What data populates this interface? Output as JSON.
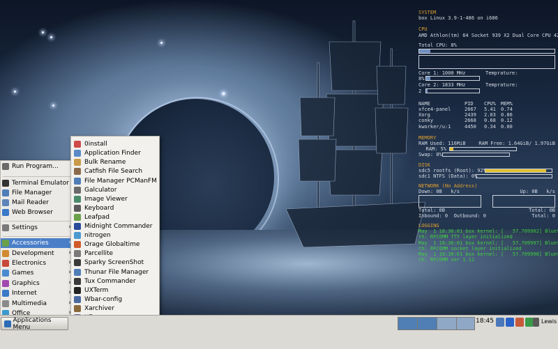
{
  "conky": {
    "system_header": "SYSTEM",
    "system_line": "box Linux 3.9-1-486 on i686",
    "cpu_header": "CPU",
    "cpu_model": "AMD Athlon(tm) 64 Socket 939 X2 Dual Core CPU 4200+",
    "total_cpu": "Total CPU: 8%",
    "total_cpu_level": 0.08,
    "core1": "Core 1: 1000 MHz",
    "core1_temp": "Temprature:",
    "core1_pct": "8%",
    "core1_level": 0.08,
    "core2": "Core 2: 1833 MHz",
    "core2_temp": "Temprature:",
    "core2_pct": "2",
    "core2_level": 0.02,
    "proc_headers": [
      "NAME",
      "PID",
      "CPU%",
      "MEM%"
    ],
    "processes": [
      [
        "xfce4-panel",
        "2667",
        "5.41",
        "0.74"
      ],
      [
        "Xorg",
        "2439",
        "2.03",
        "0.86"
      ],
      [
        "conky",
        "2668",
        "0.68",
        "0.12"
      ],
      [
        "kworker/u:1",
        "4450",
        "0.34",
        "0.00"
      ]
    ],
    "memory_header": "MEMORY",
    "ram_used": "RAM Used: 116MiB",
    "ram_free": "RAM Free: 1.64GiB/ 1.97GiB",
    "ram_pct": "RAM: 5%",
    "ram_level": 0.05,
    "swap_pct": "Swap: 0%",
    "swap_level": 0.0,
    "disk_header": "DISK",
    "disk1": "sdc5 rootfs (Root): 92%",
    "disk1_level": 0.92,
    "disk2": "sdc1 NTFS (Data): 0%",
    "disk2_level": 0.0,
    "network_header": "NETWORK (No Address)",
    "down": "Down: 0B",
    "down_unit": "k/s",
    "up": "Up: 0B",
    "up_unit": "k/s",
    "total_left": "Total: 0B",
    "total_right": "Total: 0B",
    "inbound": "Inbound: 0  Outbound: 0",
    "total_conn": "Total: 0",
    "logging_header": "LOGGING",
    "logs": [
      "May  1 18:36:01 box kernel: [   57.709902] Blueto",
      "th: RFCOMM TTY layer initialized",
      "May  1 18:36:01 box kernel: [   57.709997] Blueto",
      "th: RFCOMM socket layer initialized",
      "May  1 18:36:01 box kernel: [   57.709998] Blueto",
      "th: RFCOMM ver 1.11"
    ]
  },
  "app_menu": {
    "items": [
      {
        "label": "Run Program...",
        "icon": "run-icon",
        "color": "#6a6a6a"
      },
      {
        "label": "Terminal Emulator",
        "icon": "terminal-icon",
        "color": "#333333"
      },
      {
        "label": "File Manager",
        "icon": "folder-icon",
        "color": "#4f7db8"
      },
      {
        "label": "Mail Reader",
        "icon": "mail-icon",
        "color": "#5d84b8"
      },
      {
        "label": "Web Browser",
        "icon": "globe-icon",
        "color": "#3a78c8"
      },
      {
        "label": "Settings",
        "icon": "settings-icon",
        "color": "#7a7a7a"
      },
      {
        "label": "Accessories",
        "icon": "accessories-icon",
        "color": "#6aa04a"
      },
      {
        "label": "Development",
        "icon": "development-icon",
        "color": "#d08a30"
      },
      {
        "label": "Electronics",
        "icon": "electronics-icon",
        "color": "#c84a3a"
      },
      {
        "label": "Games",
        "icon": "games-icon",
        "color": "#4a8ad0"
      },
      {
        "label": "Graphics",
        "icon": "graphics-icon",
        "color": "#a04ab0"
      },
      {
        "label": "Internet",
        "icon": "internet-icon",
        "color": "#3a78c8"
      },
      {
        "label": "Multimedia",
        "icon": "multimedia-icon",
        "color": "#8a8a8a"
      },
      {
        "label": "Office",
        "icon": "office-icon",
        "color": "#3a9ad0"
      },
      {
        "label": "System",
        "icon": "system-icon",
        "color": "#707070"
      }
    ]
  },
  "submenu": {
    "items": [
      {
        "label": "0install",
        "icon": "zeroinstall-icon",
        "color": "#d04a4a"
      },
      {
        "label": "Application Finder",
        "icon": "app-finder-icon",
        "color": "#5a8ac8"
      },
      {
        "label": "Bulk Rename",
        "icon": "bulk-rename-icon",
        "color": "#c89a4a"
      },
      {
        "label": "Catfish File Search",
        "icon": "catfish-icon",
        "color": "#8a6a4a"
      },
      {
        "label": "File Manager PCManFM",
        "icon": "pcmanfm-icon",
        "color": "#4f7db8"
      },
      {
        "label": "Galculator",
        "icon": "calculator-icon",
        "color": "#6a6a6a"
      },
      {
        "label": "Image Viewer",
        "icon": "image-viewer-icon",
        "color": "#4a8a6a"
      },
      {
        "label": "Keyboard",
        "icon": "keyboard-icon",
        "color": "#5a5a5a"
      },
      {
        "label": "Leafpad",
        "icon": "leafpad-icon",
        "color": "#6aa04a"
      },
      {
        "label": "Midnight Commander",
        "icon": "midnight-commander-icon",
        "color": "#2a4a9a"
      },
      {
        "label": "nitrogen",
        "icon": "nitrogen-icon",
        "color": "#4a9ad0"
      },
      {
        "label": "Orage Globaltime",
        "icon": "globaltime-icon",
        "color": "#d05a2a"
      },
      {
        "label": "Parcellite",
        "icon": "parcellite-icon",
        "color": "#7a7a7a"
      },
      {
        "label": "Sparky ScreenShot",
        "icon": "screenshot-icon",
        "color": "#3a3a3a"
      },
      {
        "label": "Thunar File Manager",
        "icon": "thunar-icon",
        "color": "#4f7db8"
      },
      {
        "label": "Tux Commander",
        "icon": "tux-commander-icon",
        "color": "#3a3a3a"
      },
      {
        "label": "UXTerm",
        "icon": "uxterm-icon",
        "color": "#222222"
      },
      {
        "label": "Wbar-config",
        "icon": "wbar-config-icon",
        "color": "#4a6aa0"
      },
      {
        "label": "Xarchiver",
        "icon": "xarchiver-icon",
        "color": "#8a6a3a"
      },
      {
        "label": "Xfburn",
        "icon": "xfburn-icon",
        "color": "#6a6a9a"
      },
      {
        "label": "XTerm",
        "icon": "xterm-icon",
        "color": "#222222"
      }
    ]
  },
  "taskbar": {
    "app_menu_label": "Applications Menu",
    "clock": "18:45",
    "user": "Lewis",
    "tray_icons": [
      "network-icon",
      "bluetooth-icon",
      "sparky-icon",
      "notification-icon",
      "volume-icon"
    ]
  }
}
